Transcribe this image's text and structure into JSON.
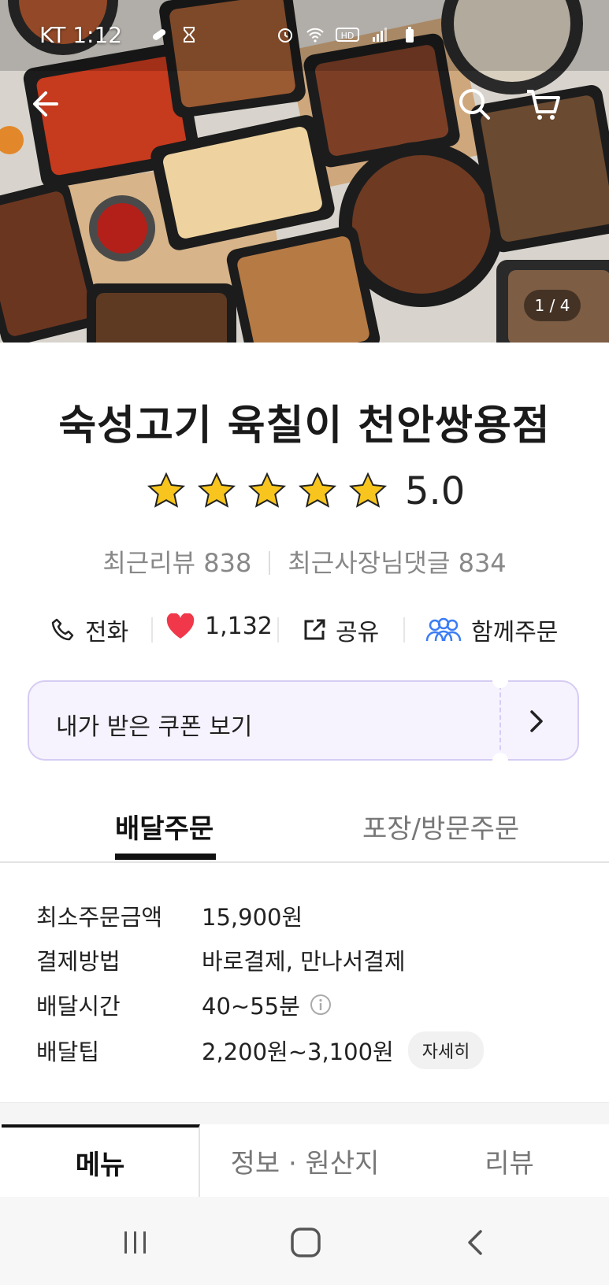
{
  "status_bar": {
    "time": "KT 1:12",
    "icons": [
      "bandage-icon",
      "hourglass-icon",
      "alarm-icon",
      "wifi-icon",
      "hd-call-icon",
      "signal-icon",
      "battery-icon"
    ]
  },
  "hero": {
    "page_indicator": "1 / 4",
    "icons": [
      "back-arrow-icon",
      "search-icon",
      "cart-icon"
    ]
  },
  "shop": {
    "name": "숙성고기 육칠이 천안쌍용점",
    "rating": "5.0",
    "stars": 5,
    "recent_reviews_label": "최근리뷰 838",
    "owner_replies_label": "최근사장님댓글 834"
  },
  "actions": {
    "call": "전화",
    "likes": "1,132",
    "share": "공유",
    "group_order": "함께주문"
  },
  "coupon": {
    "label": "내가 받은 쿠폰 보기"
  },
  "order_tabs": {
    "delivery": "배달주문",
    "pickup": "포장/방문주문"
  },
  "info": {
    "min_order_label": "최소주문금액",
    "min_order_value": "15,900원",
    "payment_label": "결제방법",
    "payment_value": "바로결제, 만나서결제",
    "delivery_time_label": "배달시간",
    "delivery_time_value": "40~55분",
    "delivery_tip_label": "배달팁",
    "delivery_tip_value": "2,200원~3,100원",
    "detail_button": "자세히"
  },
  "bottom_tabs": {
    "menu": "메뉴",
    "info_origin": "정보 · 원산지",
    "review": "리뷰"
  },
  "colors": {
    "accent_purple": "#d6ccf3",
    "coupon_bg": "#f6f3ff",
    "heart": "#f0384a",
    "group_icon": "#3b7cf5",
    "star": "#f7c51d"
  }
}
